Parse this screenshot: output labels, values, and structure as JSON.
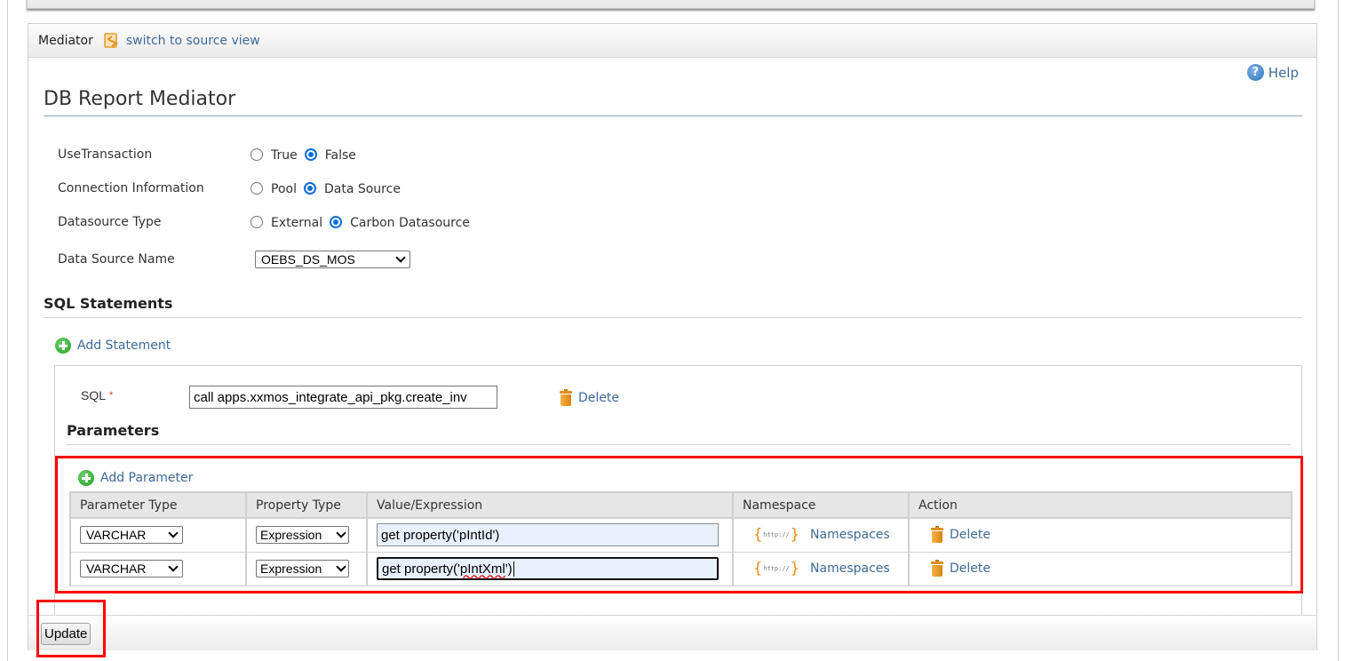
{
  "mediator_header": {
    "title": "Mediator",
    "switch_link": "switch to source view",
    "switch_icon": "source-view-icon"
  },
  "help": {
    "label": "Help",
    "icon": "help-icon"
  },
  "page_title": "DB Report Mediator",
  "form": {
    "use_transaction": {
      "label": "UseTransaction",
      "options": [
        "True",
        "False"
      ],
      "selected": "False"
    },
    "connection_information": {
      "label": "Connection Information",
      "options": [
        "Pool",
        "Data Source"
      ],
      "selected": "Data Source"
    },
    "datasource_type": {
      "label": "Datasource Type",
      "options": [
        "External",
        "Carbon Datasource"
      ],
      "selected": "Carbon Datasource"
    },
    "data_source_name": {
      "label": "Data Source Name",
      "value": "OEBS_DS_MOS"
    }
  },
  "sql_statements": {
    "title": "SQL Statements",
    "add_label": "Add Statement",
    "statement": {
      "sql_label": "SQL",
      "required_mark": "*",
      "sql_value": "call apps.xxmos_integrate_api_pkg.create_inv",
      "delete_label": "Delete"
    }
  },
  "parameters": {
    "title": "Parameters",
    "add_label": "Add Parameter",
    "columns": [
      "Parameter Type",
      "Property Type",
      "Value/Expression",
      "Namespace",
      "Action"
    ],
    "rows": [
      {
        "parameter_type": "VARCHAR",
        "property_type": "Expression",
        "value_prefix": "get property('",
        "value_name": "pIntId",
        "value_suffix": "')",
        "namespace_label": "Namespaces",
        "action_label": "Delete"
      },
      {
        "parameter_type": "VARCHAR",
        "property_type": "Expression",
        "value_prefix": "get property('",
        "value_name": "pIntXml",
        "value_suffix": "')",
        "namespace_label": "Namespaces",
        "action_label": "Delete"
      }
    ]
  },
  "footer": {
    "update_label": "Update"
  },
  "colors": {
    "link": "#3d6a98",
    "highlight": "#ff0000",
    "radio_checked": "#0a6cd6"
  }
}
